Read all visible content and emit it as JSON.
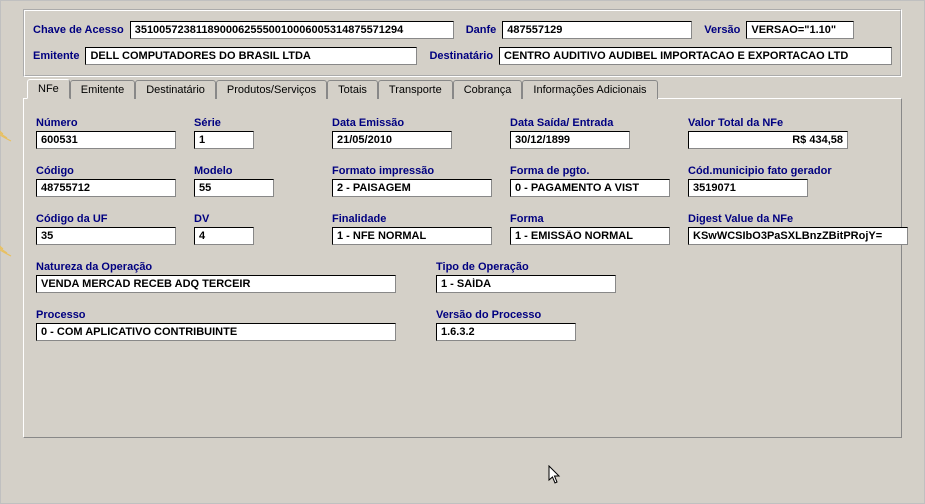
{
  "header": {
    "chave_label": "Chave de Acesso",
    "chave_value": "35100572381189000625550010006005314875571294",
    "danfe_label": "Danfe",
    "danfe_value": "487557129",
    "versao_label": "Versão",
    "versao_value": "VERSAO=\"1.10\"",
    "emitente_label": "Emitente",
    "emitente_value": "DELL COMPUTADORES DO BRASIL LTDA",
    "destinatario_label": "Destinatário",
    "destinatario_value": "CENTRO AUDITIVO AUDIBEL IMPORTACAO E EXPORTACAO LTD"
  },
  "tabs": {
    "nfe": "NFe",
    "emitente": "Emitente",
    "destinatario": "Destinatário",
    "produtos": "Produtos/Serviços",
    "totais": "Totais",
    "transporte": "Transporte",
    "cobranca": "Cobrança",
    "info": "Informações Adicionais"
  },
  "fields": {
    "numero": {
      "label": "Número",
      "value": "600531"
    },
    "serie": {
      "label": "Série",
      "value": "1"
    },
    "data_emissao": {
      "label": "Data Emissão",
      "value": "21/05/2010"
    },
    "data_saida": {
      "label": "Data Saída/ Entrada",
      "value": "30/12/1899"
    },
    "valor_total": {
      "label": "Valor Total da NFe",
      "value": "R$ 434,58"
    },
    "codigo": {
      "label": "Código",
      "value": "48755712"
    },
    "modelo": {
      "label": "Modelo",
      "value": "55"
    },
    "formato": {
      "label": "Formato impressão",
      "value": "2 - PAISAGEM"
    },
    "pgto": {
      "label": "Forma de pgto.",
      "value": "0 - PAGAMENTO A VIST"
    },
    "cod_mun": {
      "label": "Cód.municipio fato gerador",
      "value": "3519071"
    },
    "cod_uf": {
      "label": "Código da UF",
      "value": "35"
    },
    "dv": {
      "label": "DV",
      "value": "4"
    },
    "finalidade": {
      "label": "Finalidade",
      "value": "1 - NFE NORMAL"
    },
    "forma": {
      "label": "Forma",
      "value": "1 - EMISSÃO NORMAL"
    },
    "digest": {
      "label": "Digest Value da NFe",
      "value": "KSwWCSIbO3PaSXLBnzZBitPRojY="
    },
    "natureza": {
      "label": "Natureza da Operação",
      "value": "VENDA MERCAD RECEB ADQ TERCEIR"
    },
    "tipo_op": {
      "label": "Tipo de Operação",
      "value": "1 - SAÍDA"
    },
    "processo": {
      "label": "Processo",
      "value": "0 - COM APLICATIVO CONTRIBUINTE"
    },
    "versao_proc": {
      "label": "Versão do Processo",
      "value": "1.6.3.2"
    }
  }
}
